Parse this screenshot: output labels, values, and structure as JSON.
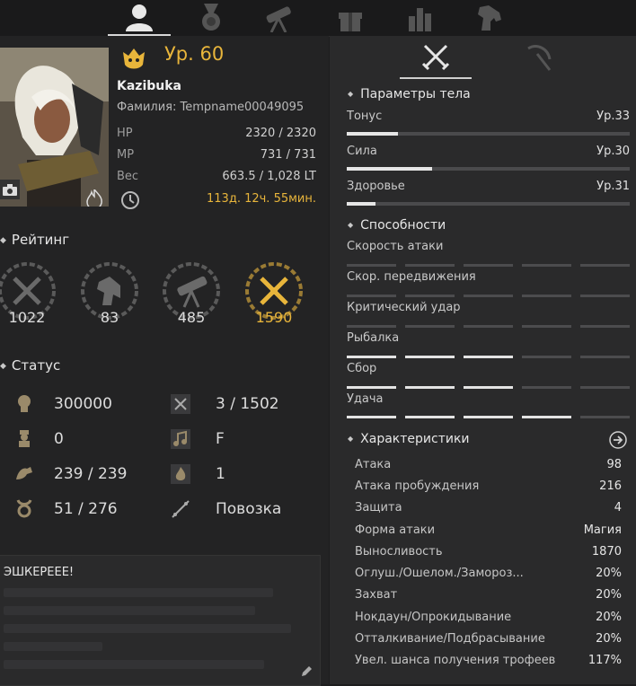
{
  "top_tabs": [
    "character-tab",
    "quest-tab",
    "knowledge-tab",
    "gift-tab",
    "stats-tab",
    "pet-tab"
  ],
  "profile": {
    "level_label": "Ур. 60",
    "name": "Kazibuka",
    "family": "Фамилия: Tempname00049095",
    "stats": [
      {
        "label": "HP",
        "value": "2320 / 2320"
      },
      {
        "label": "MP",
        "value": "731 / 731"
      },
      {
        "label": "Вес",
        "value": "663.5 / 1,028 LT"
      }
    ],
    "playtime": "113д. 12ч. 55мин."
  },
  "rating": {
    "title": "Рейтинг",
    "items": [
      {
        "icon": "swords-icon",
        "value": "1022"
      },
      {
        "icon": "horse-icon",
        "value": "83"
      },
      {
        "icon": "telescope-icon",
        "value": "485"
      },
      {
        "icon": "crossed-swords-gold-icon",
        "value": "1590"
      }
    ]
  },
  "status": {
    "title": "Статус",
    "left": [
      {
        "icon": "energy-icon",
        "value": "300000"
      },
      {
        "icon": "contribution-icon",
        "value": "0"
      },
      {
        "icon": "strength-icon",
        "value": "239 / 239"
      },
      {
        "icon": "knowledge-icon",
        "value": "51 / 276"
      }
    ],
    "right": [
      {
        "icon": "skill-points-icon",
        "value": "3 / 1502"
      },
      {
        "icon": "music-icon",
        "value": "F"
      },
      {
        "icon": "flame-icon",
        "value": "1"
      },
      {
        "icon": "carriage-icon",
        "value": "Повозка"
      }
    ]
  },
  "bio": {
    "title": "ЭШКЕРЕЕЕ!"
  },
  "right": {
    "tabs": [
      "combat-tab",
      "life-tab"
    ],
    "body": {
      "title": "Параметры тела",
      "items": [
        {
          "label": "Тонус",
          "level": "Ур.33",
          "progress": 0.18
        },
        {
          "label": "Сила",
          "level": "Ур.30",
          "progress": 0.3
        },
        {
          "label": "Здоровье",
          "level": "Ур.31",
          "progress": 0.1
        }
      ]
    },
    "abilities": {
      "title": "Способности",
      "items": [
        {
          "label": "Скорость атаки",
          "filled": 0
        },
        {
          "label": "Скор. передвижения",
          "filled": 0
        },
        {
          "label": "Критический удар",
          "filled": 0
        },
        {
          "label": "Рыбалка",
          "filled": 3
        },
        {
          "label": "Сбор",
          "filled": 3
        },
        {
          "label": "Удача",
          "filled": 4
        }
      ]
    },
    "characteristics": {
      "title": "Характеристики",
      "items": [
        {
          "label": "Атака",
          "value": "98"
        },
        {
          "label": "Атака пробуждения",
          "value": "216"
        },
        {
          "label": "Защита",
          "value": "4"
        },
        {
          "label": "Форма атаки",
          "value": "Магия"
        },
        {
          "label": "Выносливость",
          "value": "1870"
        },
        {
          "label": "Оглуш./Ошелом./Замороз...",
          "value": "20%"
        },
        {
          "label": "Захват",
          "value": "20%"
        },
        {
          "label": "Нокдаун/Опрокидывание",
          "value": "20%"
        },
        {
          "label": "Отталкивание/Подбрасывание",
          "value": "20%"
        },
        {
          "label": "Увел. шанса получения трофеев",
          "value": "117%"
        }
      ]
    }
  },
  "colors": {
    "accent": "#e8b53b",
    "panel_left": "#232324",
    "panel_right": "#2a2a2b"
  }
}
